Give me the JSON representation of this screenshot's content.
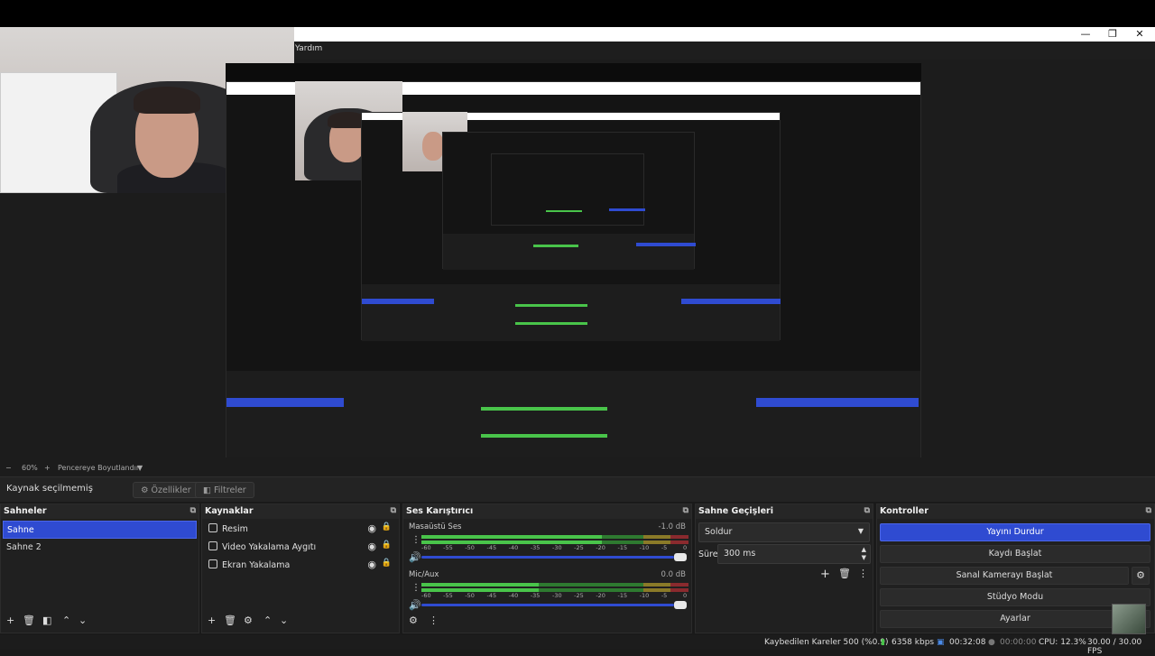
{
  "window": {
    "menu_visible": "Yardım",
    "minimize": "—",
    "restore": "❐",
    "close": "✕"
  },
  "zoom": {
    "minus": "−",
    "level": "60%",
    "plus": "+",
    "fit": "Pencereye Boyutlandır",
    "dropdown": "▼"
  },
  "source_bar": {
    "label": "Kaynak seçilmemiş",
    "properties": "Özellikler",
    "filters": "Filtreler"
  },
  "scenes": {
    "title": "Sahneler",
    "items": [
      "Sahne",
      "Sahne 2"
    ],
    "selected": 0
  },
  "sources": {
    "title": "Kaynaklar",
    "items": [
      {
        "name": "Resim",
        "icon": "image-icon"
      },
      {
        "name": "Video Yakalama Aygıtı",
        "icon": "camera-icon"
      },
      {
        "name": "Ekran Yakalama",
        "icon": "monitor-icon"
      }
    ]
  },
  "mixer": {
    "title": "Ses Karıştırıcı",
    "channels": [
      {
        "name": "Masaüstü Ses",
        "db": "-1.0 dB",
        "level": 0.83
      },
      {
        "name": "Mic/Aux",
        "db": "0.0 dB",
        "level": 0.85
      }
    ],
    "ticks": [
      "-60",
      "-55",
      "-50",
      "-45",
      "-40",
      "-35",
      "-30",
      "-25",
      "-20",
      "-15",
      "-10",
      "-5",
      "0"
    ]
  },
  "transitions": {
    "title": "Sahne Geçişleri",
    "type": "Soldur",
    "duration_label": "Süre",
    "duration": "300 ms"
  },
  "controls": {
    "title": "Kontroller",
    "buttons": [
      "Yayını Durdur",
      "Kaydı Başlat",
      "Sanal Kamerayı Başlat",
      "Stüdyo Modu",
      "Ayarlar"
    ]
  },
  "status": {
    "dropped": "Kaybedilen Kareler 500 (%0.9)",
    "bitrate": "6358 kbps",
    "stream_time": "00:32:08",
    "rec_time": "00:00:00",
    "cpu": "CPU: 12.3%",
    "fps": "30.00 / 30.00 FPS"
  },
  "colors": {
    "accent": "#2f4bd1",
    "meter_green": "#49c44a",
    "meter_yellow": "#c8b43a",
    "meter_red": "#c8343a"
  }
}
